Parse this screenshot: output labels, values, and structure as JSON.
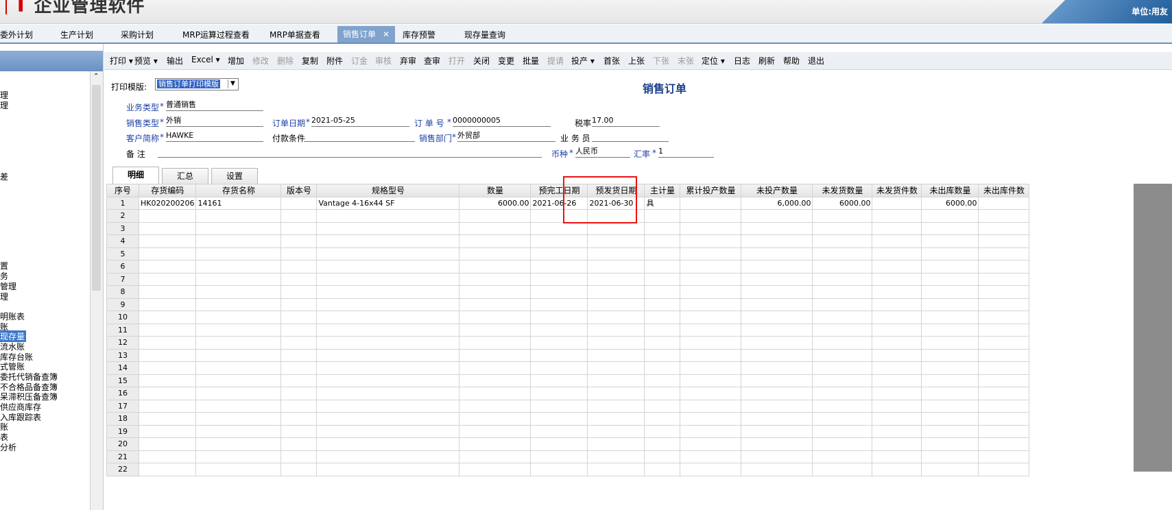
{
  "app": {
    "brand": "企业管理软件",
    "unit_label": "单位:用友"
  },
  "tabs": [
    {
      "label": "委外计划"
    },
    {
      "label": "生产计划"
    },
    {
      "label": "采购计划"
    },
    {
      "label": "MRP运算过程查看"
    },
    {
      "label": "MRP单据查看"
    },
    {
      "label": "销售订单",
      "active": true,
      "close": "✕"
    },
    {
      "label": "库存预警"
    },
    {
      "label": "现存量查询"
    }
  ],
  "sidebar": {
    "items": [
      {
        "label": "理"
      },
      {
        "label": "理"
      },
      {
        "label": "差"
      },
      {
        "label": "置"
      },
      {
        "label": "务"
      },
      {
        "label": "管理"
      },
      {
        "label": "理"
      },
      {
        "label": "明账表"
      },
      {
        "label": "账"
      },
      {
        "label": "现存量",
        "selected": true
      },
      {
        "label": "流水账"
      },
      {
        "label": "库存台账"
      },
      {
        "label": "式管账"
      },
      {
        "label": "委托代销备查簿"
      },
      {
        "label": "不合格品备查簿"
      },
      {
        "label": "呆滞积压备查簿"
      },
      {
        "label": "供应商库存"
      },
      {
        "label": "入库跟踪表"
      },
      {
        "label": "账"
      },
      {
        "label": "表"
      },
      {
        "label": "分析"
      }
    ]
  },
  "toolbar": {
    "items": [
      {
        "label": "打印 ▾",
        "enabled": true
      },
      {
        "label": "预览 ▾",
        "enabled": true
      },
      {
        "label": "输出",
        "enabled": true
      },
      {
        "label": "Excel ▾",
        "enabled": true
      },
      {
        "label": "增加",
        "enabled": true
      },
      {
        "label": "修改",
        "enabled": false
      },
      {
        "label": "删除",
        "enabled": false
      },
      {
        "label": "复制",
        "enabled": true
      },
      {
        "label": "附件",
        "enabled": true
      },
      {
        "label": "订金",
        "enabled": false
      },
      {
        "label": "审核",
        "enabled": false
      },
      {
        "label": "弃审",
        "enabled": true
      },
      {
        "label": "查审",
        "enabled": true
      },
      {
        "label": "打开",
        "enabled": false
      },
      {
        "label": "关闭",
        "enabled": true
      },
      {
        "label": "变更",
        "enabled": true
      },
      {
        "label": "批量",
        "enabled": true
      },
      {
        "label": "提请",
        "enabled": false
      },
      {
        "label": "投产 ▾",
        "enabled": true
      },
      {
        "label": "首张",
        "enabled": true
      },
      {
        "label": "上张",
        "enabled": true
      },
      {
        "label": "下张",
        "enabled": false
      },
      {
        "label": "末张",
        "enabled": false
      },
      {
        "label": "定位 ▾",
        "enabled": true
      },
      {
        "label": "日志",
        "enabled": true
      },
      {
        "label": "刷新",
        "enabled": true
      },
      {
        "label": "帮助",
        "enabled": true
      },
      {
        "label": "退出",
        "enabled": true
      }
    ]
  },
  "form": {
    "title": "销售订单",
    "print_template_label": "打印模版:",
    "print_template_value": "销售订单打印模版",
    "fields": {
      "business_type": {
        "label": "业务类型",
        "value": "普通销售"
      },
      "sales_type": {
        "label": "销售类型",
        "value": "外销"
      },
      "order_date": {
        "label": "订单日期",
        "value": "2021-05-25"
      },
      "order_no": {
        "label": "订 单 号",
        "value": "0000000005"
      },
      "tax_rate": {
        "label": "税率",
        "value": "17.00"
      },
      "customer": {
        "label": "客户简称",
        "value": "HAWKE"
      },
      "payment_terms": {
        "label": "付款条件",
        "value": ""
      },
      "sales_dept": {
        "label": "销售部门",
        "value": "外贸部"
      },
      "salesperson": {
        "label": "业 务 员",
        "value": ""
      },
      "remark": {
        "label": "备    注",
        "value": ""
      },
      "currency": {
        "label": "币种",
        "value": "人民币"
      },
      "exchange_rate": {
        "label": "汇率",
        "value": "1"
      }
    },
    "required_mark": "*"
  },
  "detail_tabs": [
    {
      "label": "明细",
      "active": true
    },
    {
      "label": "汇总"
    },
    {
      "label": "设置"
    }
  ],
  "grid": {
    "columns": [
      "序号",
      "存货编码",
      "存货名称",
      "版本号",
      "规格型号",
      "数量",
      "预完工日期",
      "预发货日期",
      "主计量",
      "累计投产数量",
      "未投产数量",
      "未发货数量",
      "未发货件数",
      "未出库数量",
      "未出库件数"
    ],
    "rows": [
      [
        "1",
        "HK020200206",
        "14161",
        "",
        "Vantage 4-16x44 SF",
        "6000.00",
        "2021-06-26",
        "2021-06-30",
        "具",
        "",
        "6,000.00",
        "6000.00",
        "",
        "6000.00",
        ""
      ],
      [
        "2",
        "",
        "",
        "",
        "",
        "",
        "",
        "",
        "",
        "",
        "",
        "",
        "",
        "",
        ""
      ],
      [
        "3",
        "",
        "",
        "",
        "",
        "",
        "",
        "",
        "",
        "",
        "",
        "",
        "",
        "",
        ""
      ],
      [
        "4",
        "",
        "",
        "",
        "",
        "",
        "",
        "",
        "",
        "",
        "",
        "",
        "",
        "",
        ""
      ],
      [
        "5",
        "",
        "",
        "",
        "",
        "",
        "",
        "",
        "",
        "",
        "",
        "",
        "",
        "",
        ""
      ],
      [
        "6",
        "",
        "",
        "",
        "",
        "",
        "",
        "",
        "",
        "",
        "",
        "",
        "",
        "",
        ""
      ],
      [
        "7",
        "",
        "",
        "",
        "",
        "",
        "",
        "",
        "",
        "",
        "",
        "",
        "",
        "",
        ""
      ],
      [
        "8",
        "",
        "",
        "",
        "",
        "",
        "",
        "",
        "",
        "",
        "",
        "",
        "",
        "",
        ""
      ],
      [
        "9",
        "",
        "",
        "",
        "",
        "",
        "",
        "",
        "",
        "",
        "",
        "",
        "",
        "",
        ""
      ],
      [
        "10",
        "",
        "",
        "",
        "",
        "",
        "",
        "",
        "",
        "",
        "",
        "",
        "",
        "",
        ""
      ],
      [
        "11",
        "",
        "",
        "",
        "",
        "",
        "",
        "",
        "",
        "",
        "",
        "",
        "",
        "",
        ""
      ],
      [
        "12",
        "",
        "",
        "",
        "",
        "",
        "",
        "",
        "",
        "",
        "",
        "",
        "",
        "",
        ""
      ],
      [
        "13",
        "",
        "",
        "",
        "",
        "",
        "",
        "",
        "",
        "",
        "",
        "",
        "",
        "",
        ""
      ],
      [
        "14",
        "",
        "",
        "",
        "",
        "",
        "",
        "",
        "",
        "",
        "",
        "",
        "",
        "",
        ""
      ],
      [
        "15",
        "",
        "",
        "",
        "",
        "",
        "",
        "",
        "",
        "",
        "",
        "",
        "",
        "",
        ""
      ],
      [
        "16",
        "",
        "",
        "",
        "",
        "",
        "",
        "",
        "",
        "",
        "",
        "",
        "",
        "",
        ""
      ],
      [
        "17",
        "",
        "",
        "",
        "",
        "",
        "",
        "",
        "",
        "",
        "",
        "",
        "",
        "",
        ""
      ],
      [
        "18",
        "",
        "",
        "",
        "",
        "",
        "",
        "",
        "",
        "",
        "",
        "",
        "",
        "",
        ""
      ],
      [
        "19",
        "",
        "",
        "",
        "",
        "",
        "",
        "",
        "",
        "",
        "",
        "",
        "",
        "",
        ""
      ],
      [
        "20",
        "",
        "",
        "",
        "",
        "",
        "",
        "",
        "",
        "",
        "",
        "",
        "",
        "",
        ""
      ],
      [
        "21",
        "",
        "",
        "",
        "",
        "",
        "",
        "",
        "",
        "",
        "",
        "",
        "",
        "",
        ""
      ],
      [
        "22",
        "",
        "",
        "",
        "",
        "",
        "",
        "",
        "",
        "",
        "",
        "",
        "",
        "",
        ""
      ]
    ]
  },
  "colors": {
    "accent": "#7fa3cc",
    "highlight_box": "#e11111",
    "label_blue": "#1c3fa8"
  }
}
